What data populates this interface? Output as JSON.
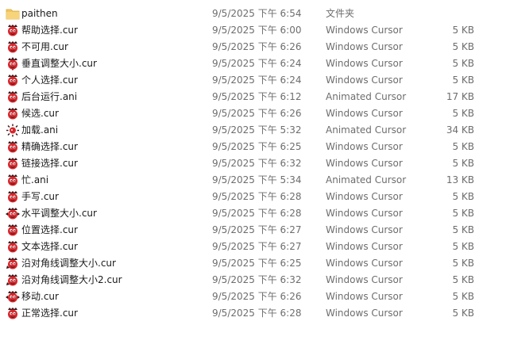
{
  "files": [
    {
      "name": "paithen",
      "date": "9/5/2025 下午 6:54",
      "type": "文件夹",
      "size": "",
      "icon": "folder-icon"
    },
    {
      "name": "帮助选择.cur",
      "date": "9/5/2025 下午 6:00",
      "type": "Windows Cursor",
      "size": "5 KB",
      "icon": "cursor-icon"
    },
    {
      "name": "不可用.cur",
      "date": "9/5/2025 下午 6:26",
      "type": "Windows Cursor",
      "size": "5 KB",
      "icon": "cursor-icon"
    },
    {
      "name": "垂直调整大小.cur",
      "date": "9/5/2025 下午 6:24",
      "type": "Windows Cursor",
      "size": "5 KB",
      "icon": "cursor-vertical-icon"
    },
    {
      "name": "个人选择.cur",
      "date": "9/5/2025 下午 6:24",
      "type": "Windows Cursor",
      "size": "5 KB",
      "icon": "cursor-icon"
    },
    {
      "name": "后台运行.ani",
      "date": "9/5/2025 下午 6:12",
      "type": "Animated Cursor",
      "size": "17 KB",
      "icon": "animated-cursor-icon"
    },
    {
      "name": "候选.cur",
      "date": "9/5/2025 下午 6:26",
      "type": "Windows Cursor",
      "size": "5 KB",
      "icon": "cursor-icon"
    },
    {
      "name": "加载.ani",
      "date": "9/5/2025 下午 5:32",
      "type": "Animated Cursor",
      "size": "34 KB",
      "icon": "busy-cursor-icon"
    },
    {
      "name": "精确选择.cur",
      "date": "9/5/2025 下午 6:25",
      "type": "Windows Cursor",
      "size": "5 KB",
      "icon": "cursor-icon"
    },
    {
      "name": "链接选择.cur",
      "date": "9/5/2025 下午 6:32",
      "type": "Windows Cursor",
      "size": "5 KB",
      "icon": "cursor-icon"
    },
    {
      "name": "忙.ani",
      "date": "9/5/2025 下午 5:34",
      "type": "Animated Cursor",
      "size": "13 KB",
      "icon": "animated-cursor-icon"
    },
    {
      "name": "手写.cur",
      "date": "9/5/2025 下午 6:28",
      "type": "Windows Cursor",
      "size": "5 KB",
      "icon": "cursor-icon"
    },
    {
      "name": "水平调整大小.cur",
      "date": "9/5/2025 下午 6:28",
      "type": "Windows Cursor",
      "size": "5 KB",
      "icon": "cursor-horizontal-icon"
    },
    {
      "name": "位置选择.cur",
      "date": "9/5/2025 下午 6:27",
      "type": "Windows Cursor",
      "size": "5 KB",
      "icon": "cursor-icon"
    },
    {
      "name": "文本选择.cur",
      "date": "9/5/2025 下午 6:27",
      "type": "Windows Cursor",
      "size": "5 KB",
      "icon": "cursor-icon"
    },
    {
      "name": "沿对角线调整大小.cur",
      "date": "9/5/2025 下午 6:25",
      "type": "Windows Cursor",
      "size": "5 KB",
      "icon": "cursor-diagonal-icon"
    },
    {
      "name": "沿对角线调整大小2.cur",
      "date": "9/5/2025 下午 6:32",
      "type": "Windows Cursor",
      "size": "5 KB",
      "icon": "cursor-diagonal-icon"
    },
    {
      "name": "移动.cur",
      "date": "9/5/2025 下午 6:26",
      "type": "Windows Cursor",
      "size": "5 KB",
      "icon": "cursor-move-icon"
    },
    {
      "name": "正常选择.cur",
      "date": "9/5/2025 下午 6:28",
      "type": "Windows Cursor",
      "size": "5 KB",
      "icon": "cursor-icon"
    }
  ],
  "colors": {
    "folder": "#f2c55c",
    "cursor_red": "#d8262b",
    "cursor_dark": "#3a1416",
    "text": "#1a1a1a",
    "meta": "#6d6d6d"
  }
}
